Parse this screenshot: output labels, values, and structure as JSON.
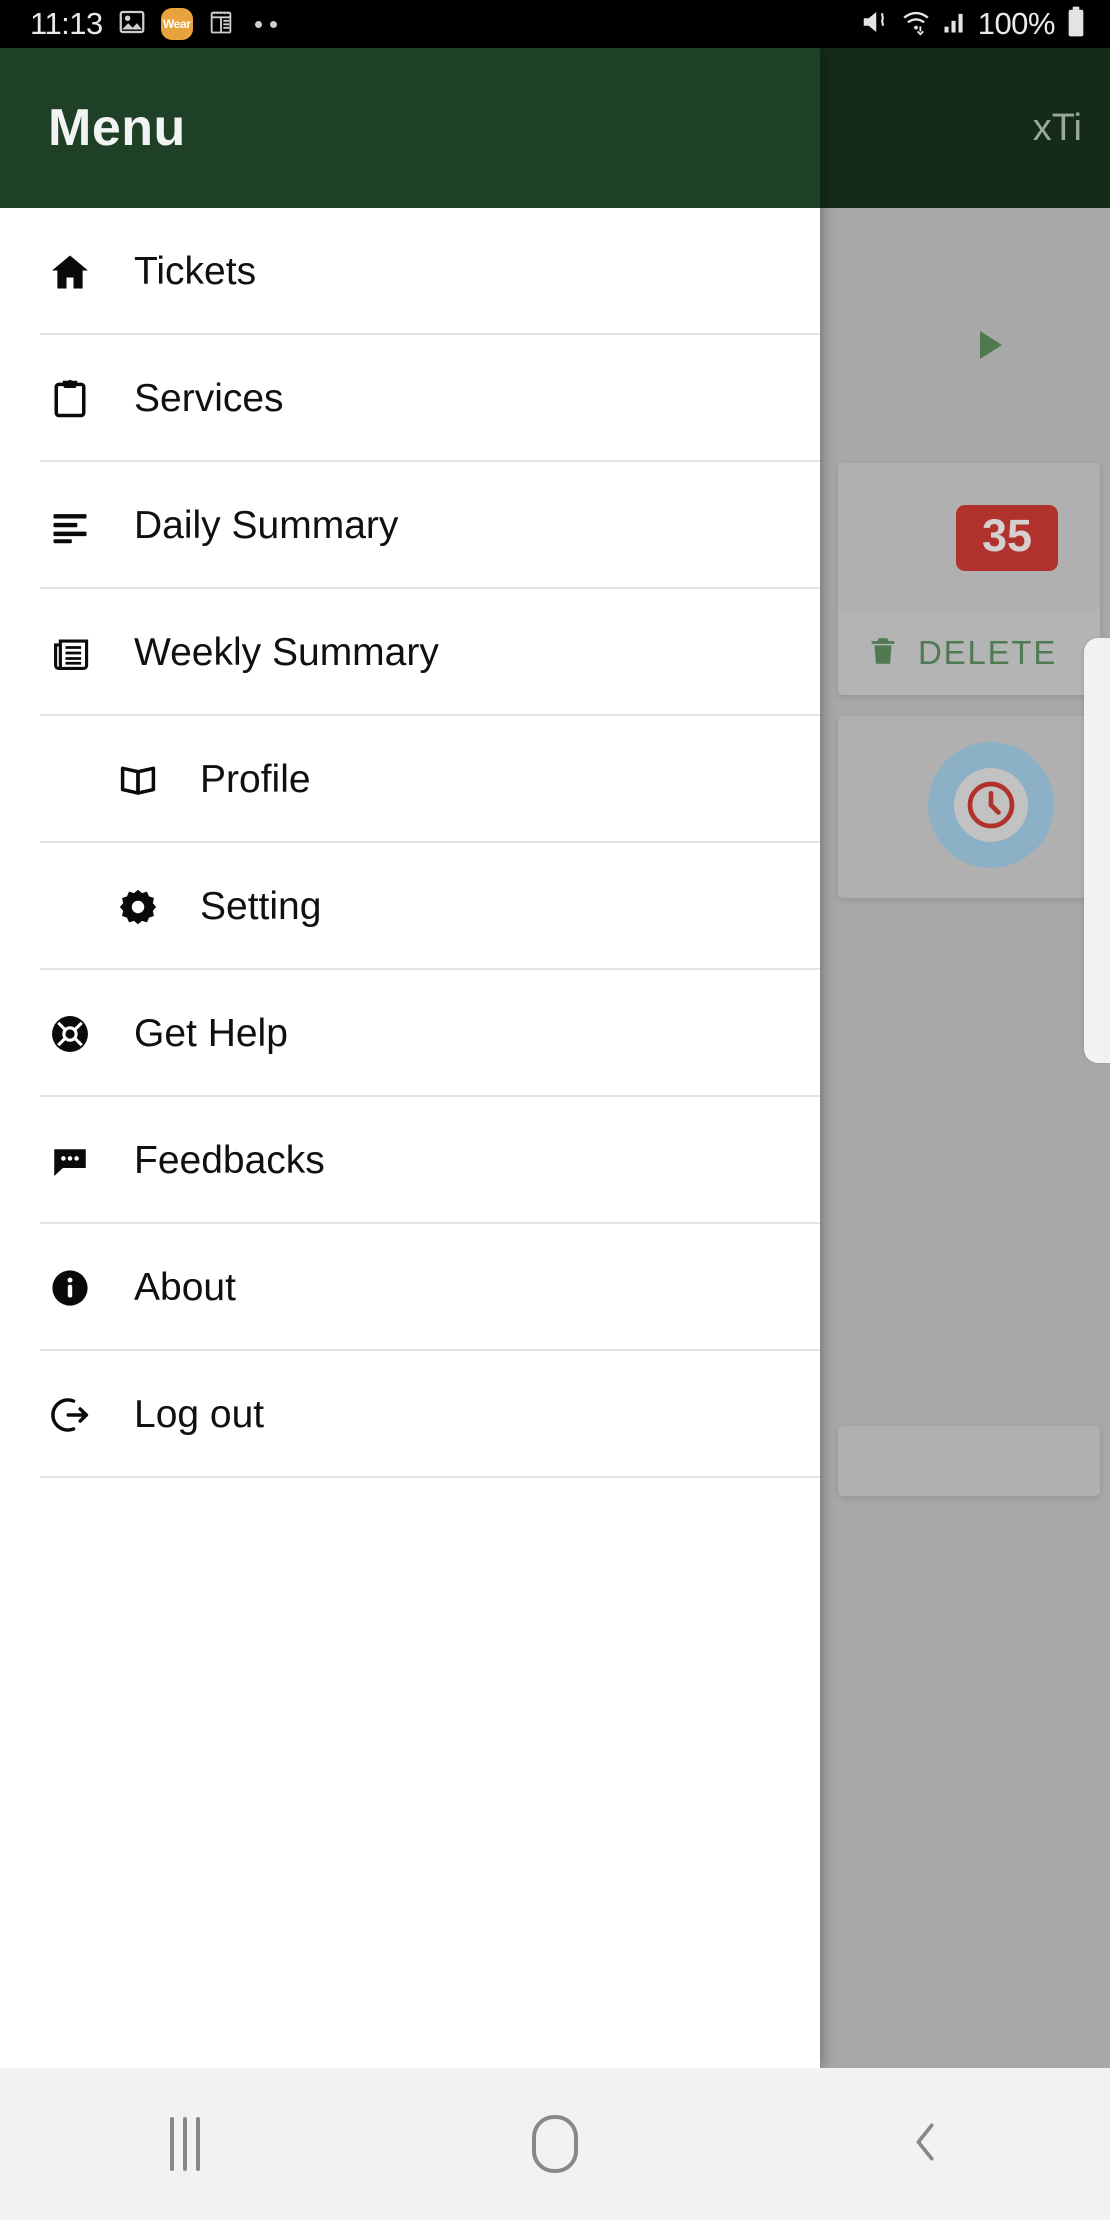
{
  "status_bar": {
    "clock": "11:13",
    "battery_percent": "100%",
    "icons": [
      "photos-icon",
      "wear-badge",
      "notes-icon",
      "overflow-dots-icon",
      "vibrate-icon",
      "wifi-icon",
      "signal-icon",
      "battery-icon"
    ],
    "wear_badge_label": "Wear",
    "wear_badge_color": "#e8a33d"
  },
  "drawer": {
    "title": "Menu",
    "header_color": "#1e4026",
    "background_color": "#ffffff",
    "items": [
      {
        "label": "Tickets",
        "icon": "home-icon",
        "indented": false
      },
      {
        "label": "Services",
        "icon": "clipboard-icon",
        "indented": false
      },
      {
        "label": "Daily Summary",
        "icon": "list-icon",
        "indented": false
      },
      {
        "label": "Weekly Summary",
        "icon": "newspaper-icon",
        "indented": false
      },
      {
        "label": "Profile",
        "icon": "book-icon",
        "indented": true
      },
      {
        "label": "Setting",
        "icon": "gear-icon",
        "indented": true
      },
      {
        "label": "Get Help",
        "icon": "lifebuoy-icon",
        "indented": false
      },
      {
        "label": "Feedbacks",
        "icon": "chat-icon",
        "indented": false
      },
      {
        "label": "About",
        "icon": "info-icon",
        "indented": false
      },
      {
        "label": "Log out",
        "icon": "logout-icon",
        "indented": false
      }
    ]
  },
  "behind_app": {
    "title": "xTi",
    "header_color": "#152b1a",
    "scrim_color": "#a8a8a8",
    "card_one": {
      "badge_value": "35",
      "badge_color": "#b1322c",
      "delete_label": "DELETE",
      "delete_color": "#4f7a52"
    },
    "card_two": {
      "ring_color": "#8cb0c6",
      "clock_color": "#b1322c"
    },
    "play_icon": "play-triangle-icon",
    "play_color": "#4e7a52"
  },
  "nav_bar": {
    "recents_label": "recents-icon",
    "home_label": "home-icon",
    "back_label": "back-icon",
    "background_color": "#f2f2f2"
  }
}
